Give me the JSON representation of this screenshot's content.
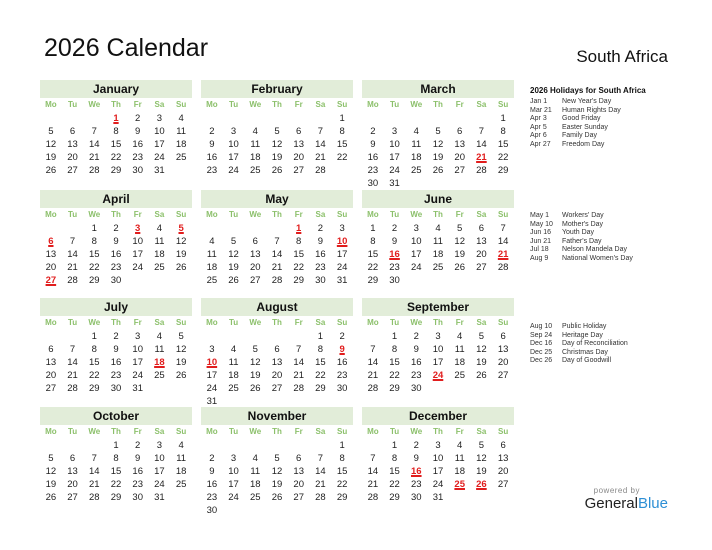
{
  "header": {
    "title": "2026 Calendar",
    "country": "South Africa"
  },
  "weekdays": [
    "Mo",
    "Tu",
    "We",
    "Th",
    "Fr",
    "Sa",
    "Su"
  ],
  "months": [
    {
      "name": "January",
      "offset": 3,
      "days": 31,
      "holidays": [
        1
      ]
    },
    {
      "name": "February",
      "offset": 6,
      "days": 28,
      "holidays": []
    },
    {
      "name": "March",
      "offset": 6,
      "days": 31,
      "holidays": [
        21
      ]
    },
    {
      "name": "April",
      "offset": 2,
      "days": 30,
      "holidays": [
        3,
        5,
        6,
        27
      ]
    },
    {
      "name": "May",
      "offset": 4,
      "days": 31,
      "holidays": [
        1,
        10
      ]
    },
    {
      "name": "June",
      "offset": 0,
      "days": 30,
      "holidays": [
        16,
        21
      ]
    },
    {
      "name": "July",
      "offset": 2,
      "days": 31,
      "holidays": [
        18
      ]
    },
    {
      "name": "August",
      "offset": 5,
      "days": 31,
      "holidays": [
        9,
        10
      ]
    },
    {
      "name": "September",
      "offset": 1,
      "days": 30,
      "holidays": [
        24
      ]
    },
    {
      "name": "October",
      "offset": 3,
      "days": 31,
      "holidays": []
    },
    {
      "name": "November",
      "offset": 6,
      "days": 30,
      "holidays": []
    },
    {
      "name": "December",
      "offset": 1,
      "days": 31,
      "holidays": [
        16,
        25,
        26
      ]
    }
  ],
  "holiday_list": {
    "title": "2026 Holidays for South Africa",
    "groups": [
      [
        {
          "date": "Jan 1",
          "name": "New Year's Day"
        },
        {
          "date": "Mar 21",
          "name": "Human Rights Day"
        },
        {
          "date": "Apr 3",
          "name": "Good Friday"
        },
        {
          "date": "Apr 5",
          "name": "Easter Sunday"
        },
        {
          "date": "Apr 6",
          "name": "Family Day"
        },
        {
          "date": "Apr 27",
          "name": "Freedom Day"
        }
      ],
      [
        {
          "date": "May 1",
          "name": "Workers' Day"
        },
        {
          "date": "May 10",
          "name": "Mother's Day"
        },
        {
          "date": "Jun 16",
          "name": "Youth Day"
        },
        {
          "date": "Jun 21",
          "name": "Father's Day"
        },
        {
          "date": "Jul 18",
          "name": "Nelson Mandela Day"
        },
        {
          "date": "Aug 9",
          "name": "National Women's Day"
        }
      ],
      [
        {
          "date": "Aug 10",
          "name": "Public Holiday"
        },
        {
          "date": "Sep 24",
          "name": "Heritage Day"
        },
        {
          "date": "Dec 16",
          "name": "Day of Reconciliation"
        },
        {
          "date": "Dec 25",
          "name": "Christmas Day"
        },
        {
          "date": "Dec 26",
          "name": "Day of Goodwill"
        }
      ]
    ]
  },
  "brand": {
    "powered_by": "powered by",
    "name_part1": "General",
    "name_part2": "Blue"
  },
  "colors": {
    "holiday": "#e11d1d",
    "weekday_header": "#8cc06b",
    "month_header_bg": "#e2edd9",
    "brand_blue": "#2d8fd5"
  }
}
